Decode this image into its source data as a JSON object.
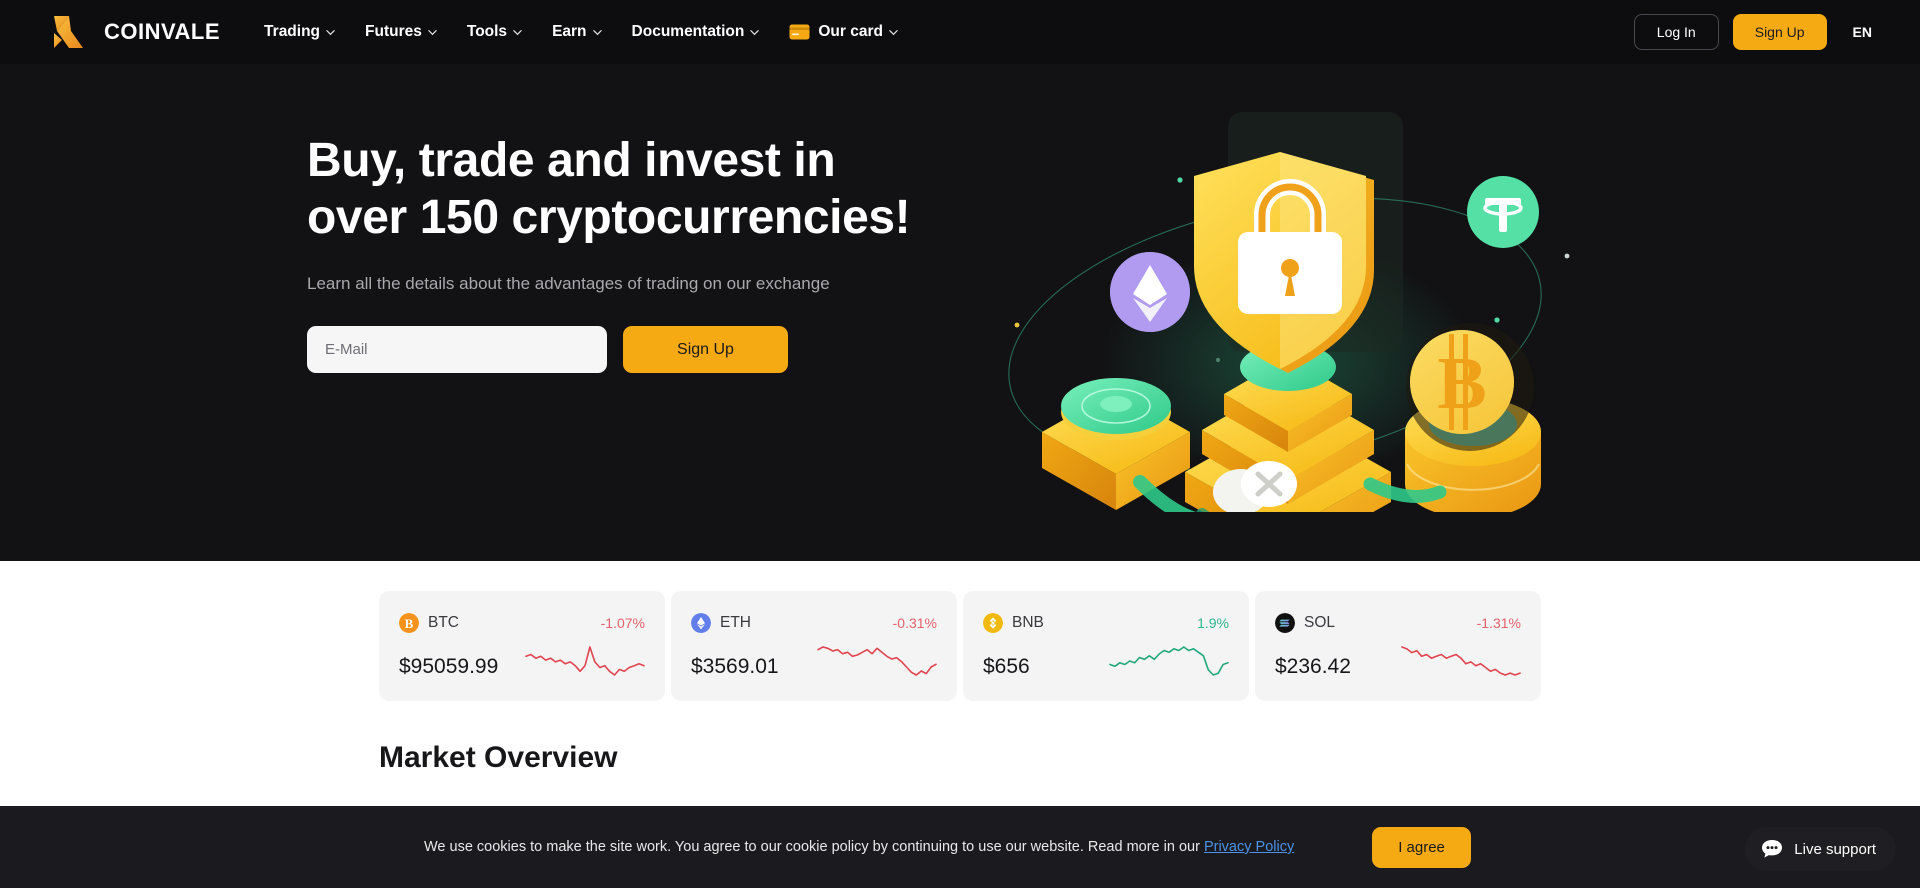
{
  "brand": {
    "name": "COINVALE",
    "logo_icon": "coinvale-logo-icon",
    "accent": "#f5aa14"
  },
  "nav": {
    "items": [
      {
        "label": "Trading",
        "icon": "chevron-down-icon"
      },
      {
        "label": "Futures",
        "icon": "chevron-down-icon"
      },
      {
        "label": "Tools",
        "icon": "chevron-down-icon"
      },
      {
        "label": "Earn",
        "icon": "chevron-down-icon"
      },
      {
        "label": "Documentation",
        "icon": "chevron-down-icon"
      },
      {
        "label": "Our card",
        "icon": "credit-card-icon"
      }
    ],
    "login_label": "Log In",
    "signup_label": "Sign Up",
    "language": "EN"
  },
  "hero": {
    "title": "Buy, trade and invest in over 150 cryptocurrencies!",
    "subtitle": "Learn all the details about the advantages of trading on our exchange",
    "email_placeholder": "E-Mail",
    "email_value": "",
    "signup_label": "Sign Up",
    "illustration": "crypto-shield-lock-illustration"
  },
  "tickers": [
    {
      "symbol": "BTC",
      "icon": "bitcoin-icon",
      "change": "-1.07%",
      "direction": "down",
      "price": "$95059.99",
      "spark": [
        14,
        13,
        15,
        14,
        16,
        15,
        17,
        16,
        18,
        17,
        19,
        22,
        19,
        9,
        17,
        20,
        19,
        22,
        24,
        21,
        22,
        20,
        19,
        18,
        19
      ],
      "color": "#e0454f",
      "icon_bg": "#f7931a"
    },
    {
      "symbol": "ETH",
      "icon": "ethereum-icon",
      "change": "-0.31%",
      "direction": "down",
      "price": "$3569.01",
      "spark": [
        9,
        7,
        8,
        10,
        9,
        12,
        11,
        14,
        13,
        11,
        9,
        12,
        8,
        11,
        14,
        16,
        15,
        18,
        22,
        26,
        28,
        25,
        27,
        22,
        20
      ],
      "color": "#e0454f",
      "icon_bg": "#627eea"
    },
    {
      "symbol": "BNB",
      "icon": "binance-icon",
      "change": "1.9%",
      "direction": "up",
      "price": "$656",
      "spark": [
        21,
        22,
        20,
        21,
        19,
        20,
        17,
        18,
        16,
        18,
        15,
        13,
        14,
        12,
        13,
        11,
        13,
        12,
        14,
        16,
        24,
        27,
        26,
        21,
        20
      ],
      "color": "#22a87c",
      "icon_bg": "#f0b90b"
    },
    {
      "symbol": "SOL",
      "icon": "solana-icon",
      "change": "-1.31%",
      "direction": "down",
      "price": "$236.42",
      "spark": [
        8,
        9,
        11,
        10,
        13,
        12,
        14,
        13,
        12,
        14,
        13,
        12,
        14,
        17,
        16,
        18,
        17,
        19,
        21,
        20,
        22,
        23,
        22,
        23,
        22
      ],
      "color": "#e0454f",
      "icon_bg": "#141414"
    }
  ],
  "market": {
    "title": "Market Overview"
  },
  "cookie": {
    "text_before": "We use cookies to make the site work. You agree to our cookie policy by continuing to use our website. Read more in our ",
    "link_label": "Privacy Policy",
    "agree_label": "I agree"
  },
  "support": {
    "label": "Live support",
    "icon": "chat-bubble-icon"
  }
}
